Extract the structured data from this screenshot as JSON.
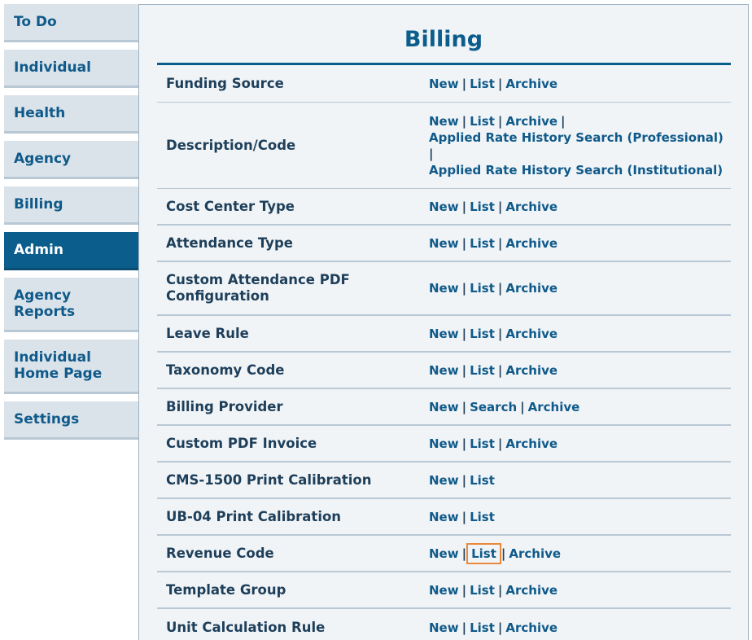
{
  "sidebar": {
    "items": [
      {
        "label": "To Do"
      },
      {
        "label": "Individual"
      },
      {
        "label": "Health"
      },
      {
        "label": "Agency"
      },
      {
        "label": "Billing"
      },
      {
        "label": "Admin"
      },
      {
        "label": "Agency Reports"
      },
      {
        "label": "Individual Home Page"
      },
      {
        "label": "Settings"
      }
    ]
  },
  "main": {
    "title": "Billing",
    "rows": [
      {
        "label": "Funding Source",
        "links": [
          "New",
          "List",
          "Archive"
        ]
      },
      {
        "label": "Description/Code",
        "links": [
          "New",
          "List",
          "Archive",
          "Applied Rate History Search (Professional)",
          "Applied Rate History Search (Institutional)"
        ]
      },
      {
        "label": "Cost Center Type",
        "links": [
          "New",
          "List",
          "Archive"
        ]
      },
      {
        "label": "Attendance Type",
        "links": [
          "New",
          "List",
          "Archive"
        ]
      },
      {
        "label": "Custom Attendance PDF Configuration",
        "links": [
          "New",
          "List",
          "Archive"
        ]
      },
      {
        "label": "Leave Rule",
        "links": [
          "New",
          "List",
          "Archive"
        ]
      },
      {
        "label": "Taxonomy Code",
        "links": [
          "New",
          "List",
          "Archive"
        ]
      },
      {
        "label": "Billing Provider",
        "links": [
          "New",
          "Search",
          "Archive"
        ]
      },
      {
        "label": "Custom PDF Invoice",
        "links": [
          "New",
          "List",
          "Archive"
        ]
      },
      {
        "label": "CMS-1500 Print Calibration",
        "links": [
          "New",
          "List"
        ]
      },
      {
        "label": "UB-04 Print Calibration",
        "links": [
          "New",
          "List"
        ]
      },
      {
        "label": "Revenue Code",
        "links": [
          "New",
          "List",
          "Archive"
        ]
      },
      {
        "label": "Template Group",
        "links": [
          "New",
          "List",
          "Archive"
        ]
      },
      {
        "label": "Unit Calculation Rule",
        "links": [
          "New",
          "List",
          "Archive"
        ]
      }
    ]
  },
  "separator": "|"
}
